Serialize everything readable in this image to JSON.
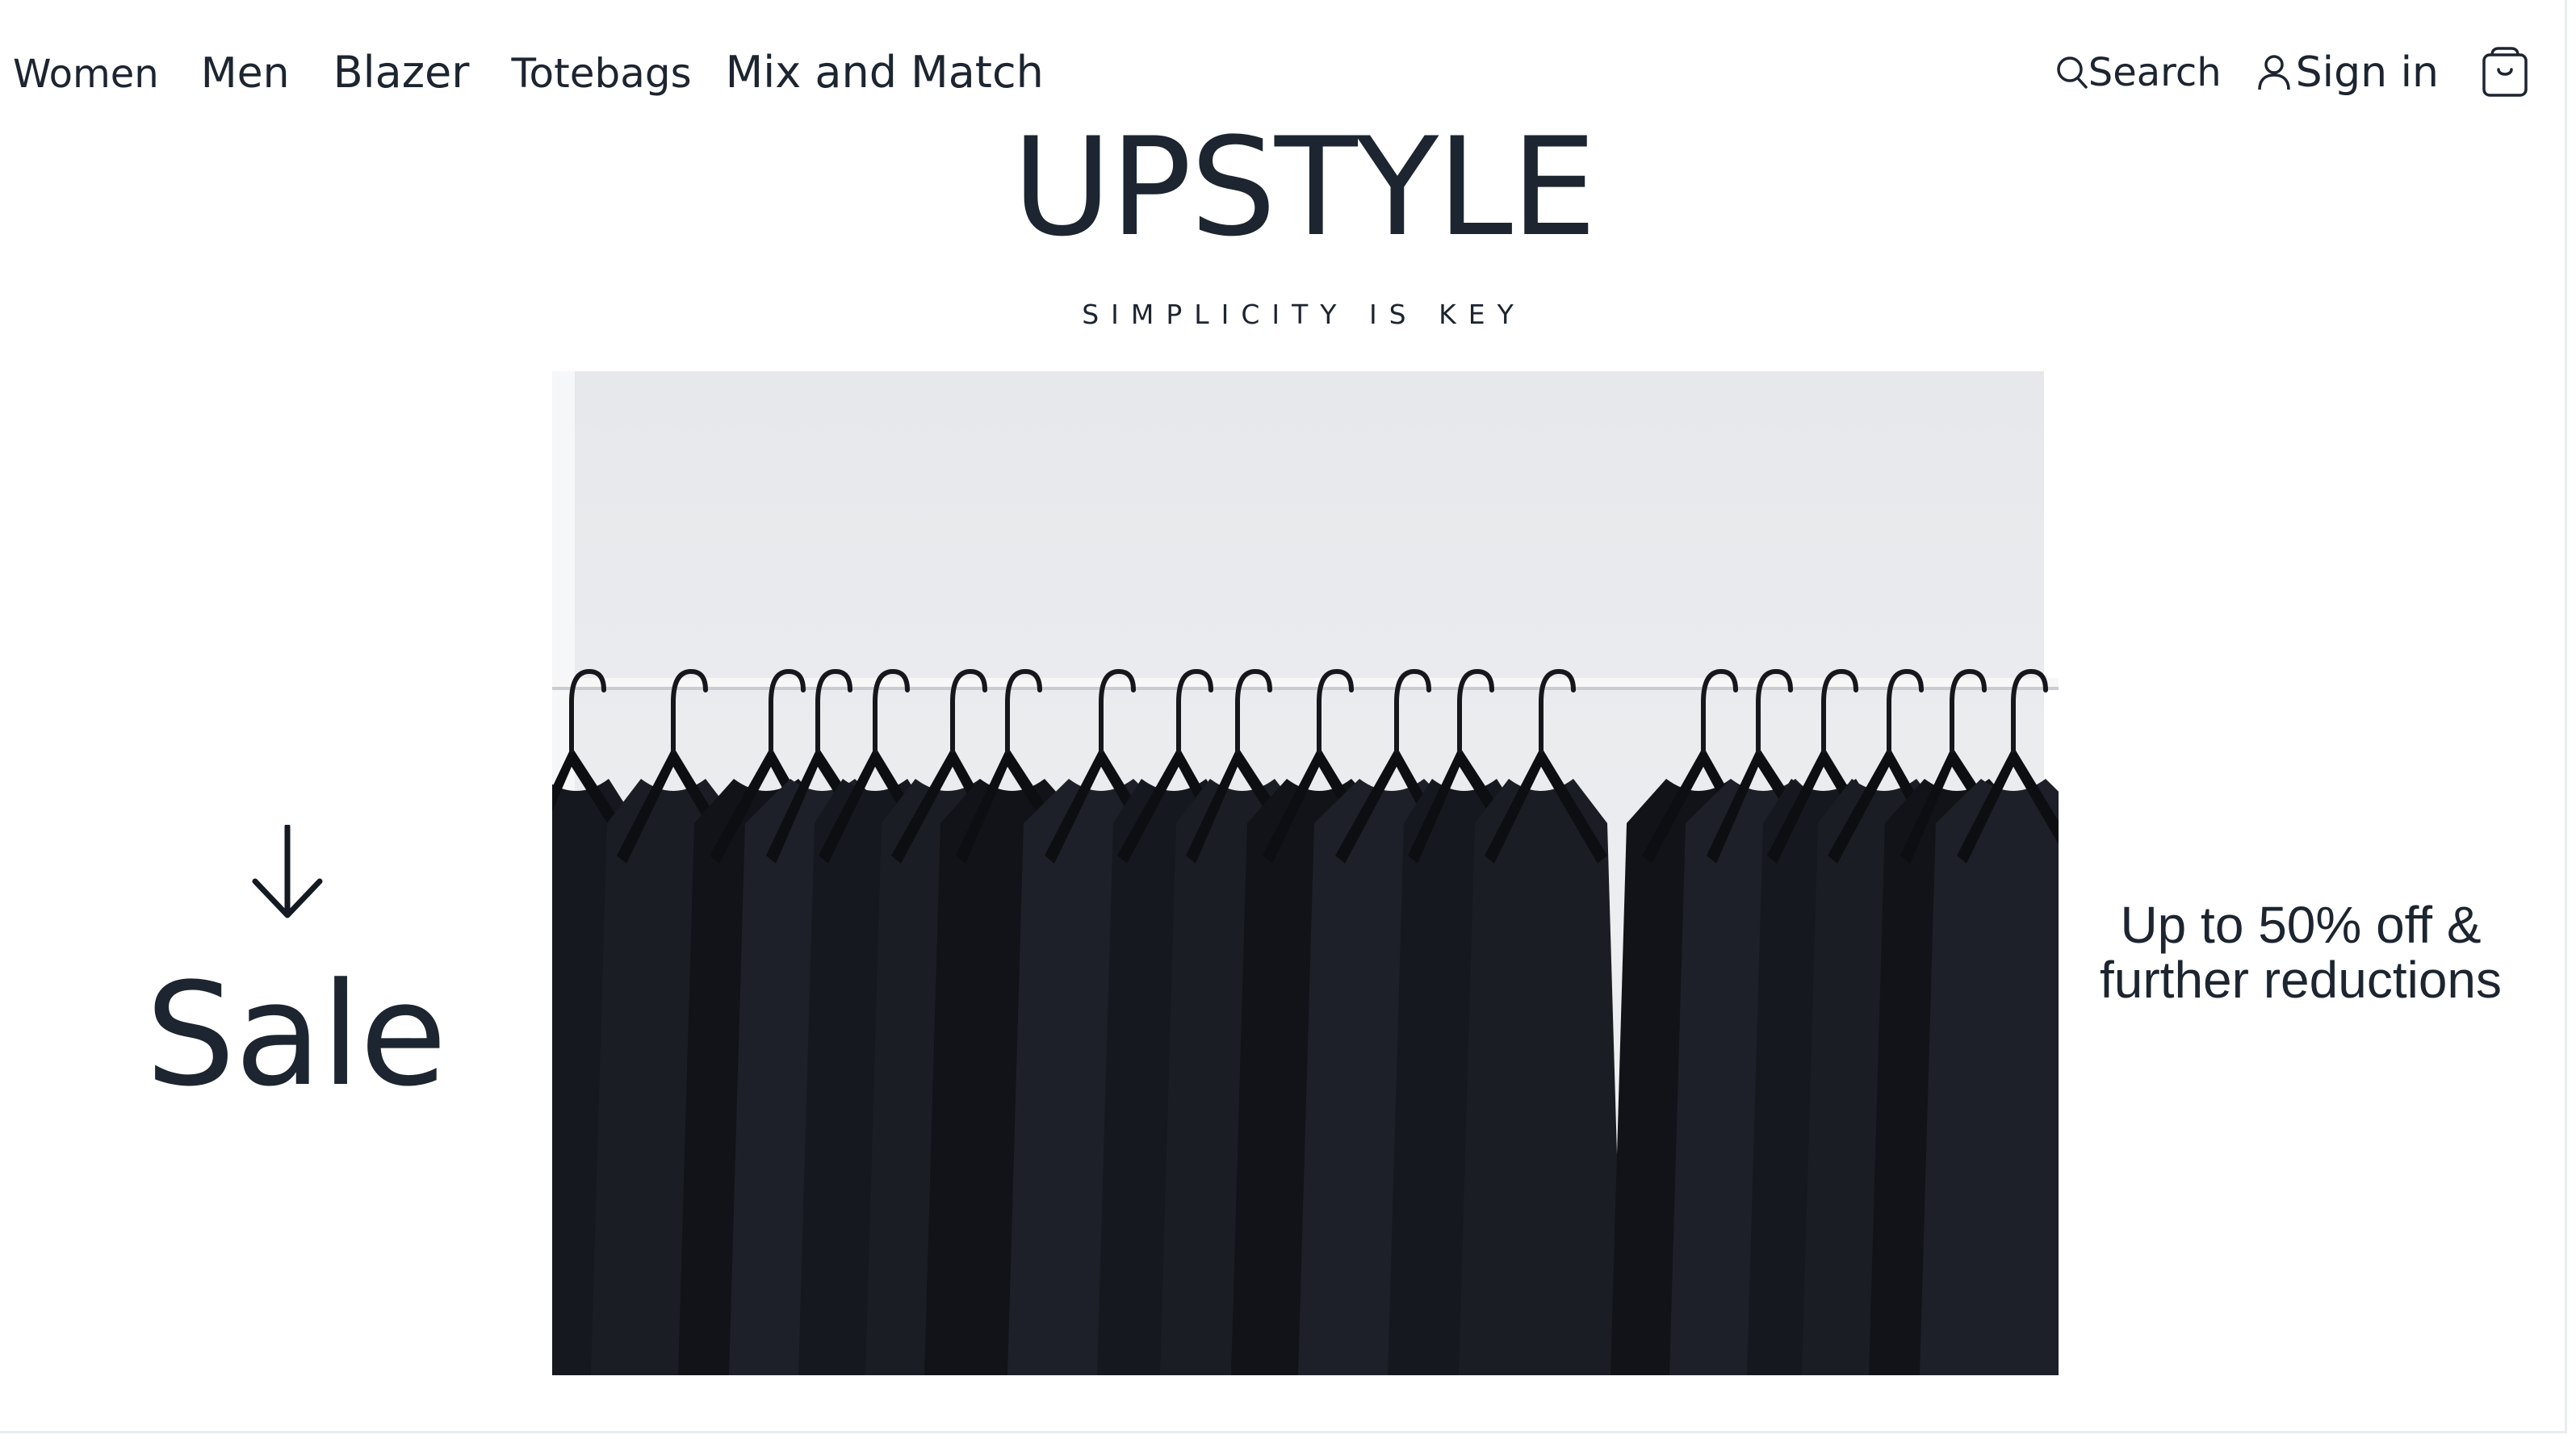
{
  "nav": {
    "items": [
      {
        "label": "Women"
      },
      {
        "label": "Men"
      },
      {
        "label": "Blazer"
      },
      {
        "label": "Totebags"
      },
      {
        "label": "Mix and Match"
      }
    ]
  },
  "utility": {
    "search_label": "Search",
    "search_icon": "search-icon",
    "signin_label": "Sign in",
    "signin_icon": "user-icon",
    "cart_icon": "shopping-bag-icon"
  },
  "brand": {
    "name": "UPSTYLE",
    "tagline": "SIMPLICITY IS KEY"
  },
  "hero": {
    "image": "black t-shirts on hangers on a white clothing rail"
  },
  "sale": {
    "arrow_icon": "arrow-down-icon",
    "label": "Sale"
  },
  "offer": {
    "line1": "Up to 50% off &",
    "line2": "further reductions"
  },
  "colors": {
    "text": "#1c2530",
    "background": "#ffffff",
    "hero_wall": "#e9ebee",
    "garment": "#16181f"
  }
}
